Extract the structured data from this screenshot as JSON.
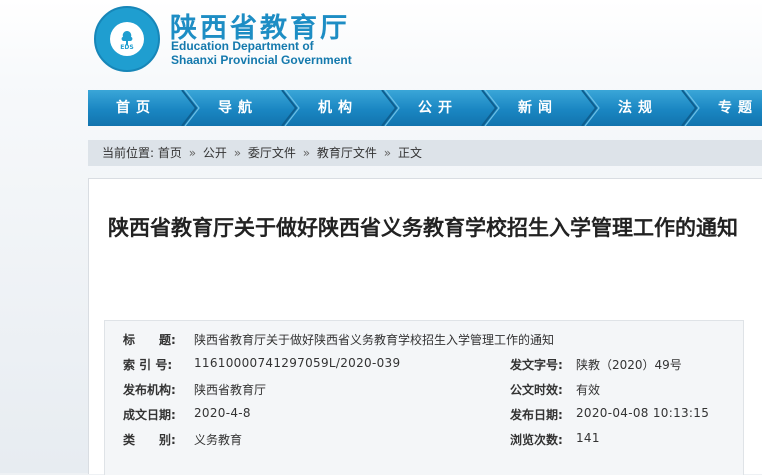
{
  "header": {
    "site_name_cn": "陕西省教育厅",
    "site_name_en_line1": "Education Department of",
    "site_name_en_line2": "Shaanxi Provincial Government",
    "logo_text": "EDS",
    "brand_color": "#1d8dc4"
  },
  "nav": {
    "items": [
      "首页",
      "导航",
      "机构",
      "公开",
      "新闻",
      "法规",
      "专题"
    ]
  },
  "breadcrumb": {
    "prefix": "当前位置:",
    "items": [
      "首页",
      "公开",
      "委厅文件",
      "教育厅文件",
      "正文"
    ],
    "separator": "»"
  },
  "article": {
    "title": "陕西省教育厅关于做好陕西省义务教育学校招生入学管理工作的通知"
  },
  "meta": {
    "title_label": "标　　题:",
    "title_value": "陕西省教育厅关于做好陕西省义务教育学校招生入学管理工作的通知",
    "index_label": "索 引 号:",
    "index_value": "11610000741297059L/2020-039",
    "doc_no_label": "发文字号:",
    "doc_no_value": "陕教（2020）49号",
    "issuer_label": "发布机构:",
    "issuer_value": "陕西省教育厅",
    "validity_label": "公文时效:",
    "validity_value": "有效",
    "written_label": "成文日期:",
    "written_value": "2020-4-8",
    "published_label": "发布日期:",
    "published_value": "2020-04-08 10:13:15",
    "category_label": "类　　别:",
    "category_value": "义务教育",
    "views_label": "浏览次数:",
    "views_value": "141"
  }
}
